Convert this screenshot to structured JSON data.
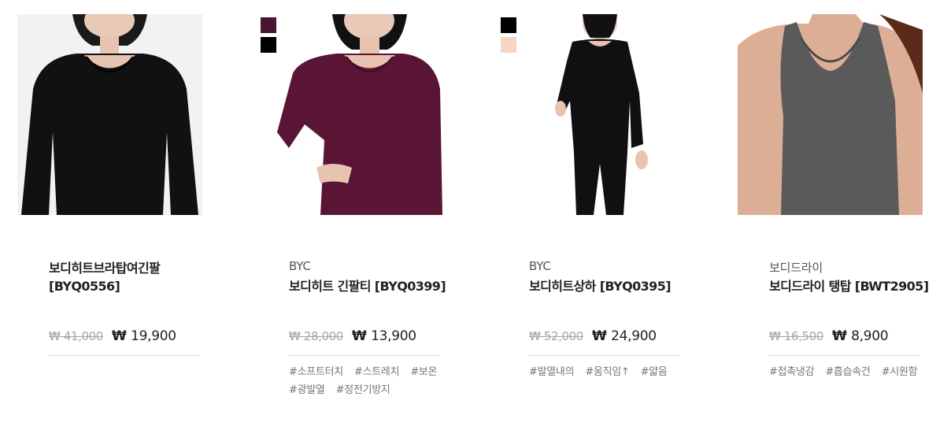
{
  "products": [
    {
      "brand": "",
      "name": "보디히트브라탑여긴팔 [BYQ0556]",
      "original_price": "₩ 41,000",
      "price_currency": "₩",
      "price_amount": "19,900",
      "colors": [],
      "tags": []
    },
    {
      "brand": "BYC",
      "name": "보디히트 긴팔티 [BYQ0399]",
      "original_price": "₩ 28,000",
      "price_currency": "₩",
      "price_amount": "13,900",
      "colors": [
        "#4a1530",
        "#000000"
      ],
      "tags": [
        "#소프트터치",
        "#스트레치",
        "#보온",
        "#광발열",
        "#정전기방지"
      ]
    },
    {
      "brand": "BYC",
      "name": "보디히트상하 [BYQ0395]",
      "original_price": "₩ 52,000",
      "price_currency": "₩",
      "price_amount": "24,900",
      "colors": [
        "#000000",
        "#f4d5c6"
      ],
      "tags": [
        "#발열내의",
        "#움직임↑",
        "#얇음"
      ]
    },
    {
      "brand": "보디드라이",
      "name": "보디드라이 탱탑 [BWT2905]",
      "original_price": "₩ 16,500",
      "price_currency": "₩",
      "price_amount": "8,900",
      "colors": [],
      "tags": [
        "#접촉냉감",
        "#흡습속건",
        "#시원함"
      ]
    }
  ]
}
